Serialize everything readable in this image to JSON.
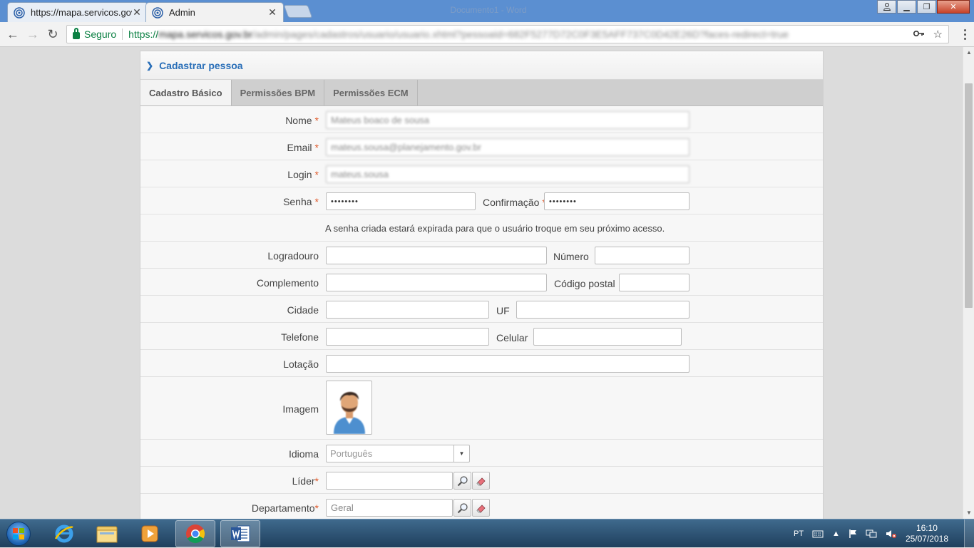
{
  "browser": {
    "tabs": [
      {
        "title": "https://mapa.servicos.gov",
        "active": false
      },
      {
        "title": "Admin",
        "active": true
      }
    ],
    "window_title": "Documento1 - Word",
    "secure_label": "Seguro",
    "url_scheme": "https://",
    "url_host": "mapa.servicos.gov.br",
    "url_path": "/admin/pages/cadastros/usuario/usuario.xhtml?pessoaId=682F5277D72C0F3E5AFF737C0D42E26D?faces-redirect=true"
  },
  "panel": {
    "title": "Cadastrar pessoa",
    "tabs": [
      "Cadastro Básico",
      "Permissões BPM",
      "Permissões ECM"
    ]
  },
  "form": {
    "nome_label": "Nome",
    "nome_value": "Mateus boaco de sousa",
    "email_label": "Email",
    "email_value": "mateus.sousa@planejamento.gov.br",
    "login_label": "Login",
    "login_value": "mateus.sousa",
    "senha_label": "Senha",
    "senha_value": "••••••••",
    "confirmacao_label": "Confirmação",
    "confirmacao_value": "••••••••",
    "required_mark": "*",
    "senha_hint": "A senha criada estará expirada para que o usuário troque em seu próximo acesso.",
    "logradouro_label": "Logradouro",
    "numero_label": "Número",
    "complemento_label": "Complemento",
    "codigo_postal_label": "Código postal",
    "cidade_label": "Cidade",
    "uf_label": "UF",
    "telefone_label": "Telefone",
    "celular_label": "Celular",
    "lotacao_label": "Lotação",
    "imagem_label": "Imagem",
    "idioma_label": "Idioma",
    "idioma_value": "Português",
    "lider_label": "Líder",
    "departamento_label": "Departamento",
    "departamento_value": "Geral"
  },
  "taskbar": {
    "language": "PT",
    "time": "16:10",
    "date": "25/07/2018"
  },
  "colors": {
    "accent": "#2a6fb8",
    "required": "#e05a2b",
    "secure": "#0b8043"
  }
}
